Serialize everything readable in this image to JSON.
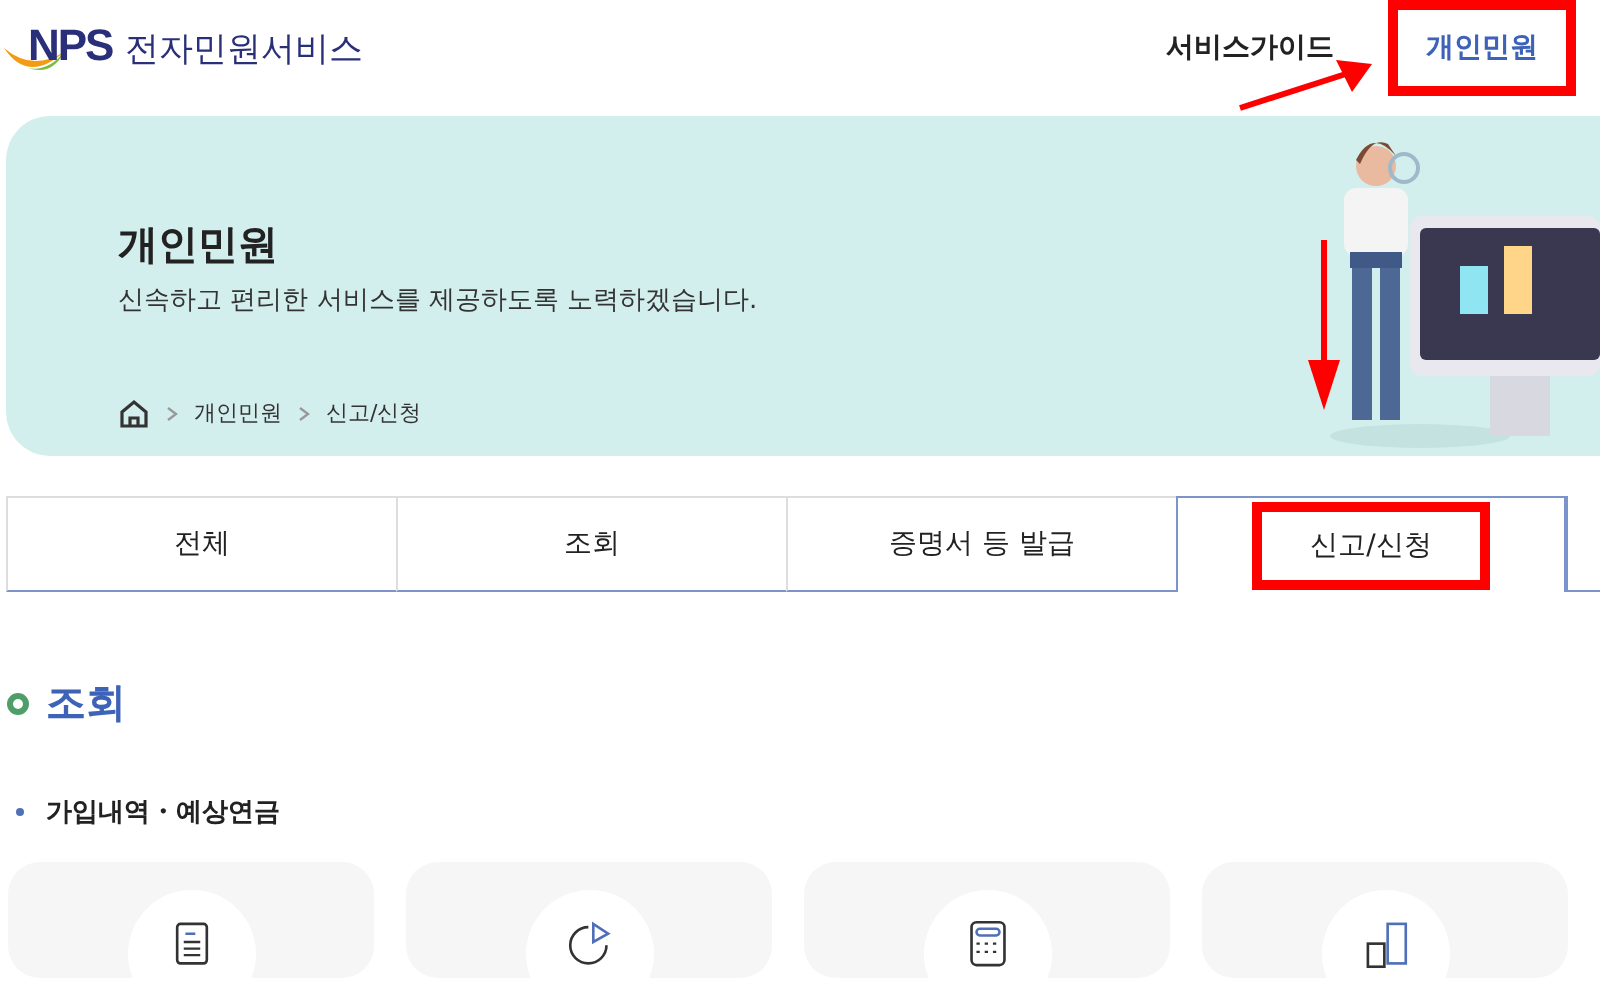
{
  "header": {
    "logo": "NPS",
    "service_name": "전자민원서비스",
    "nav": [
      {
        "label": "서비스가이드",
        "selected": false,
        "highlighted": false
      },
      {
        "label": "개인민원",
        "selected": true,
        "highlighted": true
      }
    ]
  },
  "banner": {
    "title": "개인민원",
    "subtitle": "신속하고 편리한 서비스를 제공하도록 노력하겠습니다.",
    "breadcrumb": [
      "개인민원",
      "신고/신청"
    ]
  },
  "tabs": [
    {
      "label": "전체",
      "selected": false,
      "highlighted": false
    },
    {
      "label": "조회",
      "selected": false,
      "highlighted": false
    },
    {
      "label": "증명서 등 발급",
      "selected": false,
      "highlighted": false
    },
    {
      "label": "신고/신청",
      "selected": true,
      "highlighted": true
    }
  ],
  "section": {
    "title": "조회",
    "subsection": "가입내역・예상연금",
    "cards": [
      {
        "kind": "document"
      },
      {
        "kind": "chart"
      },
      {
        "kind": "calculator"
      },
      {
        "kind": "transfer"
      }
    ]
  }
}
